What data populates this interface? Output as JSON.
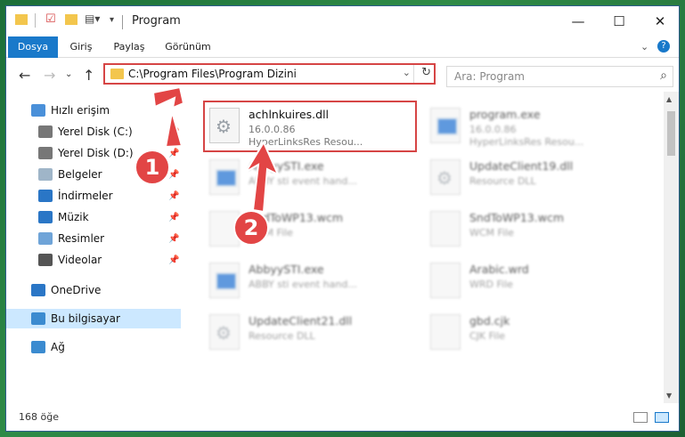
{
  "window": {
    "title": "Program",
    "controls": {
      "minimize": "—",
      "maximize": "☐",
      "close": "✕"
    }
  },
  "ribbon": {
    "tabs": [
      "Dosya",
      "Giriş",
      "Paylaş",
      "Görünüm"
    ],
    "active_tab": "Dosya"
  },
  "navigation": {
    "address_path": "C:\\Program Files\\Program Dizini",
    "search_placeholder": "Ara: Program"
  },
  "sidebar": {
    "items": [
      {
        "label": "Hızlı erişim",
        "icon": "star-icon",
        "pinned": false
      },
      {
        "label": "Yerel Disk (C:)",
        "icon": "drive-icon",
        "pinned": true
      },
      {
        "label": "Yerel Disk (D:)",
        "icon": "drive-icon",
        "pinned": true
      },
      {
        "label": "Belgeler",
        "icon": "documents-icon",
        "pinned": true
      },
      {
        "label": "İndirmeler",
        "icon": "download-icon",
        "pinned": true
      },
      {
        "label": "Müzik",
        "icon": "music-icon",
        "pinned": true
      },
      {
        "label": "Resimler",
        "icon": "pictures-icon",
        "pinned": true
      },
      {
        "label": "Videolar",
        "icon": "video-icon",
        "pinned": true
      },
      {
        "label": "OneDrive",
        "icon": "cloud-icon",
        "pinned": false
      },
      {
        "label": "Bu bilgisayar",
        "icon": "computer-icon",
        "pinned": false,
        "selected": true
      },
      {
        "label": "Ağ",
        "icon": "network-icon",
        "pinned": false
      }
    ]
  },
  "files": [
    {
      "name": "achlnkuires.dll",
      "version": "16.0.0.86",
      "desc": "HyperLinksRes Resou...",
      "type": "dll",
      "highlighted": true
    },
    {
      "name": "program.exe",
      "version": "16.0.0.86",
      "desc": "HyperLinksRes Resou...",
      "type": "exe"
    },
    {
      "name": "AbbyySTI.exe",
      "version": "ABBY sti event hand...",
      "desc": "",
      "type": "exe"
    },
    {
      "name": "UpdateClient19.dll",
      "version": "Resource DLL",
      "desc": "",
      "type": "dll"
    },
    {
      "name": "SndToWP13.wcm",
      "version": "WCM File",
      "desc": "",
      "type": "doc"
    },
    {
      "name": "SndToWP13.wcm",
      "version": "WCM File",
      "desc": "",
      "type": "doc"
    },
    {
      "name": "AbbyySTI.exe",
      "version": "ABBY sti event hand...",
      "desc": "",
      "type": "exe"
    },
    {
      "name": "Arabic.wrd",
      "version": "WRD File",
      "desc": "",
      "type": "doc"
    },
    {
      "name": "UpdateClient21.dll",
      "version": "Resource DLL",
      "desc": "",
      "type": "dll"
    },
    {
      "name": "gbd.cjk",
      "version": "CJK File",
      "desc": "",
      "type": "doc"
    }
  ],
  "status": {
    "item_count": "168 öğe"
  },
  "callouts": [
    "1",
    "2"
  ],
  "colors": {
    "accent": "#1979ca",
    "highlight": "#d64545",
    "callout": "#e24545",
    "selected": "#cce8ff"
  }
}
